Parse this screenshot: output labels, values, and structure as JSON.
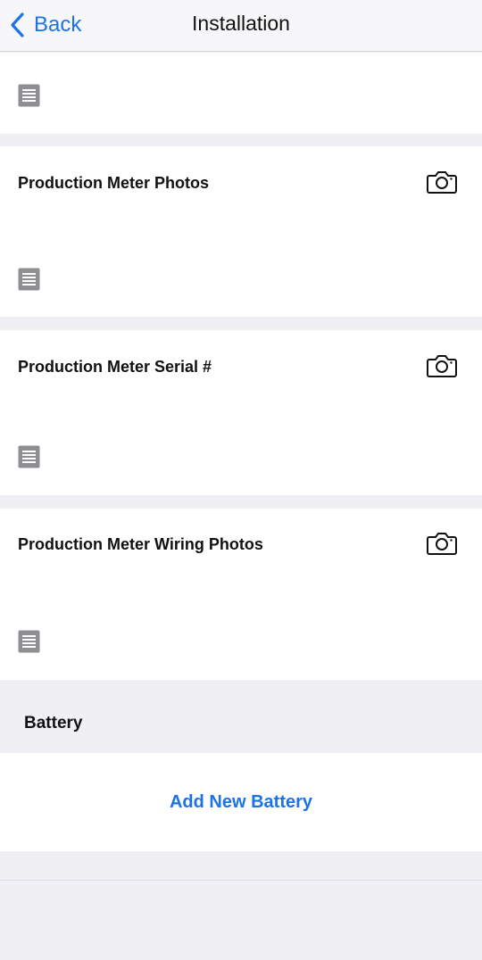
{
  "nav": {
    "back_label": "Back",
    "title": "Installation",
    "accent_color": "#1a73e8"
  },
  "cards": [
    {
      "title": "",
      "has_camera": false,
      "note_icon": "note-icon"
    },
    {
      "title": "Production Meter Photos",
      "has_camera": true,
      "camera_icon": "camera-icon",
      "note_icon": "note-icon"
    },
    {
      "title": "Production Meter Serial #",
      "has_camera": true,
      "camera_icon": "camera-icon",
      "note_icon": "note-icon"
    },
    {
      "title": "Production Meter Wiring Photos",
      "has_camera": true,
      "camera_icon": "camera-icon",
      "note_icon": "note-icon"
    }
  ],
  "battery_section": {
    "header": "Battery",
    "add_button_label": "Add New Battery"
  }
}
